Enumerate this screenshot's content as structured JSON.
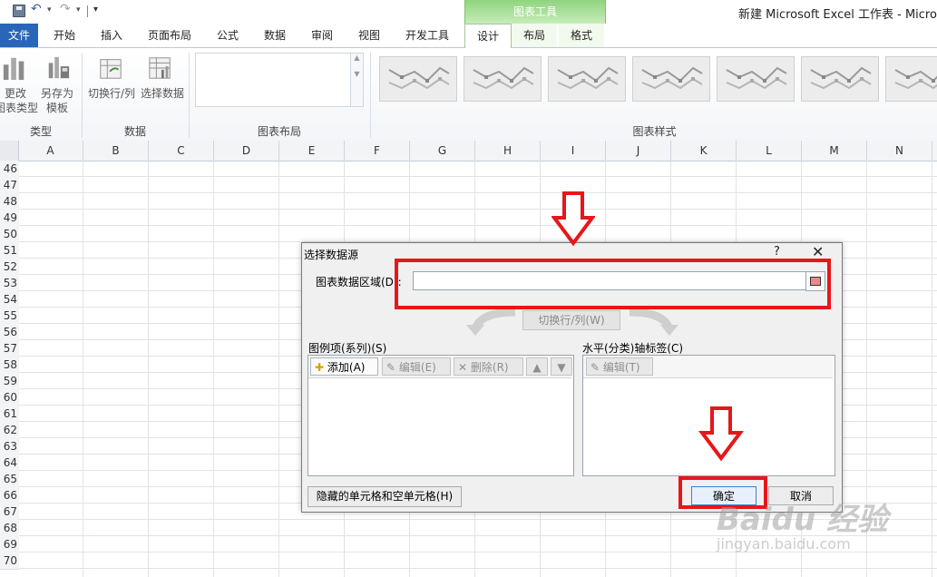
{
  "window": {
    "title": "新建 Microsoft Excel 工作表 - Microsc",
    "context_tab_group": "图表工具"
  },
  "quick_access": {
    "save_icon": "save-icon",
    "undo_icon": "undo-icon",
    "redo_icon": "redo-icon"
  },
  "tabs": [
    {
      "label": "文件"
    },
    {
      "label": "开始"
    },
    {
      "label": "插入"
    },
    {
      "label": "页面布局"
    },
    {
      "label": "公式"
    },
    {
      "label": "数据"
    },
    {
      "label": "审阅"
    },
    {
      "label": "视图"
    },
    {
      "label": "开发工具"
    },
    {
      "label": "设计"
    },
    {
      "label": "布局"
    },
    {
      "label": "格式"
    }
  ],
  "ribbon": {
    "change_type_label_1": "更改",
    "change_type_label_2": "图表类型",
    "save_template_label_1": "另存为",
    "save_template_label_2": "模板",
    "switch_row_col": "切换行/列",
    "select_data": "选择数据",
    "groups": {
      "type": "类型",
      "data": "数据",
      "chart_layout": "图表布局",
      "chart_styles": "图表样式"
    }
  },
  "sheet": {
    "columns": [
      "A",
      "B",
      "C",
      "D",
      "E",
      "F",
      "G",
      "H",
      "I",
      "J",
      "K",
      "L",
      "M",
      "N"
    ],
    "rows": [
      "46",
      "47",
      "48",
      "49",
      "50",
      "51",
      "52",
      "53",
      "54",
      "55",
      "56",
      "57",
      "58",
      "59",
      "60",
      "61",
      "62",
      "63",
      "64",
      "65",
      "66",
      "67",
      "68",
      "69",
      "70"
    ]
  },
  "dialog": {
    "title": "选择数据源",
    "help": "?",
    "close": "✕",
    "range_label": "图表数据区域(D):",
    "range_value": "",
    "switch_label": "切换行/列(W)",
    "legend_label": "图例项(系列)(S)",
    "axis_label": "水平(分类)轴标签(C)",
    "add_label": "添加(A)",
    "edit_series_label": "编辑(E)",
    "delete_label": "删除(R)",
    "up_label": "▲",
    "down_label": "▼",
    "edit_axis_label": "编辑(T)",
    "hidden_cells_label": "隐藏的单元格和空单元格(H)",
    "ok_label": "确定",
    "cancel_label": "取消"
  },
  "watermark": {
    "brand": "Baidu 经验",
    "url": "jingyan.baidu.com"
  },
  "colors": {
    "annotation_red": "#e6171b",
    "context_green": "#8fd47f",
    "file_tab_blue": "#2a66b8"
  }
}
